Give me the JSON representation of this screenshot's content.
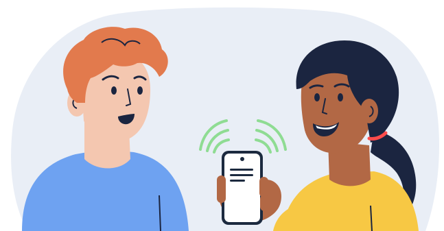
{
  "illustration": {
    "background_color": "#e9eef6",
    "people": [
      {
        "role": "man-left",
        "hair_color": "#e27a4d",
        "skin_color": "#f4c7b0",
        "shirt_color": "#6ea2f1"
      },
      {
        "role": "woman-right",
        "hair_color": "#1b2540",
        "skin_color": "#b26845",
        "shirt_color": "#f7c844",
        "hair_tie_color": "#ff4b4b"
      }
    ],
    "phone": {
      "body_color": "#1c2a3f",
      "screen_color": "#ffffff"
    },
    "signal_wave_color": "#8fdc93"
  }
}
